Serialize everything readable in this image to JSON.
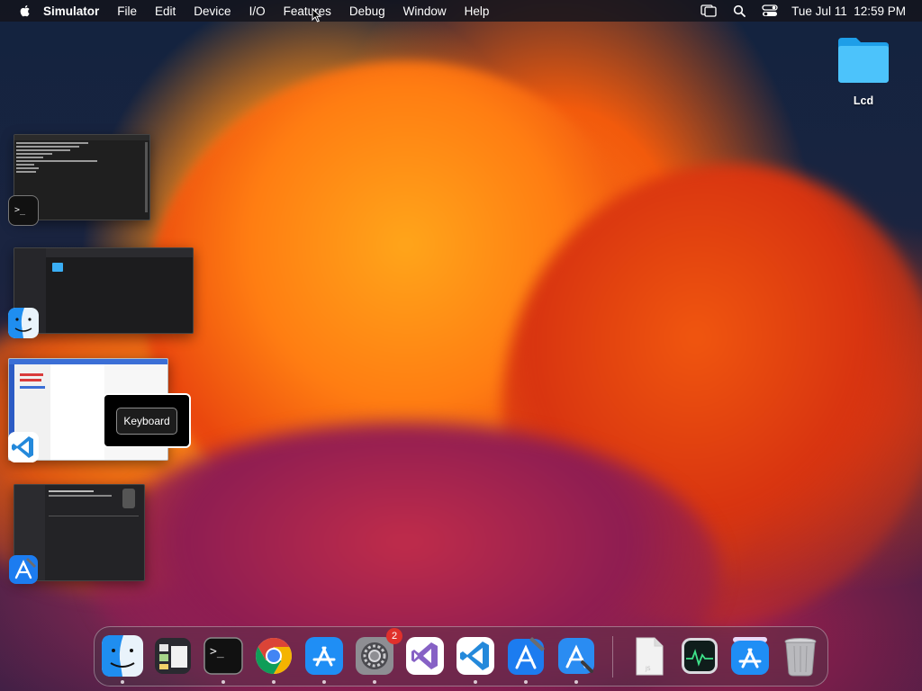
{
  "menubar": {
    "app_name": "Simulator",
    "items": [
      "File",
      "Edit",
      "Device",
      "I/O",
      "Features",
      "Debug",
      "Window",
      "Help"
    ],
    "clock": "Tue Jul 11  12:59 PM"
  },
  "desktop": {
    "folder_label": "Lcd"
  },
  "popup": {
    "button_label": "Keyboard"
  },
  "stage_manager": {
    "groups": [
      {
        "app": "Terminal",
        "icon": "terminal-icon"
      },
      {
        "app": "Finder",
        "icon": "finder-icon"
      },
      {
        "app": "Visual Studio Code",
        "icon": "vscode-icon"
      },
      {
        "app": "Xcode",
        "icon": "xcode-icon"
      }
    ]
  },
  "dock": {
    "items": [
      {
        "name": "Finder",
        "icon": "finder-icon",
        "running": true
      },
      {
        "name": "Stage Manager",
        "icon": "stage-manager-icon",
        "running": false
      },
      {
        "name": "Terminal",
        "icon": "terminal-icon",
        "running": true
      },
      {
        "name": "Google Chrome",
        "icon": "chrome-icon",
        "running": true
      },
      {
        "name": "App Store",
        "icon": "app-store-icon",
        "running": true
      },
      {
        "name": "System Settings",
        "icon": "settings-icon",
        "running": true,
        "badge": "2"
      },
      {
        "name": "Visual Studio",
        "icon": "visual-studio-icon",
        "running": false
      },
      {
        "name": "Visual Studio Code",
        "icon": "vscode-icon",
        "running": true
      },
      {
        "name": "Xcode",
        "icon": "xcode-icon",
        "running": true
      },
      {
        "name": "Instruments",
        "icon": "instruments-icon",
        "running": true
      },
      {
        "name": "Document",
        "icon": "document-icon",
        "running": false
      },
      {
        "name": "Activity Monitor",
        "icon": "activity-monitor-icon",
        "running": false
      },
      {
        "name": "App Store",
        "icon": "app-store-icon",
        "running": false
      },
      {
        "name": "Trash",
        "icon": "trash-icon",
        "running": false
      }
    ]
  }
}
